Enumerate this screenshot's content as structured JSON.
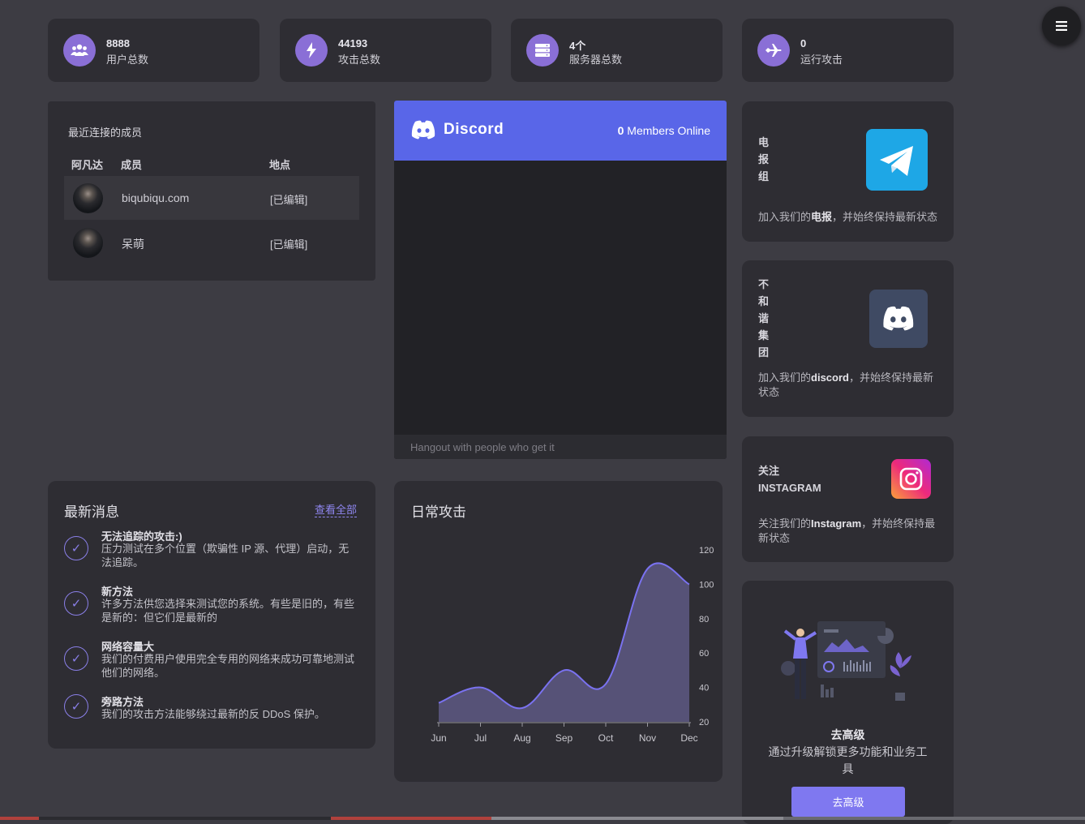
{
  "stats": [
    {
      "value": "8888",
      "label": "用户总数",
      "icon": "users-icon"
    },
    {
      "value": "44193",
      "label": "攻击总数",
      "icon": "bolt-icon"
    },
    {
      "value": "4个",
      "label": "服务器总数",
      "icon": "server-icon"
    },
    {
      "value": "0",
      "label": "运行攻击",
      "icon": "plane-icon"
    }
  ],
  "members": {
    "title": "最近连接的成员",
    "headers": {
      "avatar": "阿凡达",
      "member": "成员",
      "location": "地点"
    },
    "rows": [
      {
        "name": "biqubiqu.com",
        "location": "[已编辑]"
      },
      {
        "name": "呆萌",
        "location": "[已编辑]"
      }
    ]
  },
  "discord_widget": {
    "brand": "Discord",
    "online_count": "0",
    "online_label": "Members Online",
    "footer": "Hangout with people who get it",
    "accent": "#5966e8"
  },
  "telegram": {
    "title_chars": [
      "电",
      "报",
      "组"
    ],
    "desc_prefix": "加入我们的",
    "desc_bold": "电报",
    "desc_suffix": "，并始终保持最新状态",
    "color": "#1ea7e6"
  },
  "discord_card": {
    "title_chars": [
      "不",
      "和",
      "谐",
      "集",
      "团"
    ],
    "desc_prefix": "加入我们的",
    "desc_bold": "discord",
    "desc_suffix": "，并始终保持最新状态"
  },
  "instagram": {
    "title_line1": "关注",
    "title_line2": "INSTAGRAM",
    "desc_prefix": "关注我们的",
    "desc_bold": "Instagram",
    "desc_suffix": "，并始终保持最新状态"
  },
  "news": {
    "title": "最新消息",
    "view_all": "查看全部",
    "items": [
      {
        "title": "无法追踪的攻击:)",
        "desc": "压力测试在多个位置（欺骗性 IP 源、代理）启动，无法追踪。"
      },
      {
        "title": "新方法",
        "desc": "许多方法供您选择来测试您的系统。有些是旧的，有些是新的：但它们是最新的"
      },
      {
        "title": "网络容量大",
        "desc": "我们的付费用户使用完全专用的网络来成功可靠地测试他们的网络。"
      },
      {
        "title": "旁路方法",
        "desc": "我们的攻击方法能够绕过最新的反 DDoS 保护。"
      }
    ]
  },
  "chart_section": {
    "title": "日常攻击"
  },
  "chart_data": {
    "type": "area",
    "categories": [
      "Jun",
      "Jul",
      "Aug",
      "Sep",
      "Oct",
      "Nov",
      "Dec"
    ],
    "series": [
      {
        "values": [
          31,
          40,
          28,
          50,
          42,
          109,
          100
        ]
      }
    ],
    "ylim": [
      20,
      120
    ],
    "yticks": [
      20,
      40,
      60,
      80,
      100,
      120
    ],
    "color": "#7a72f0",
    "fill": "#565277"
  },
  "upgrade": {
    "title": "去高级",
    "desc": "通过升级解锁更多功能和业务工具",
    "button": "去高级"
  },
  "menu_icon": "hamburger-icon"
}
